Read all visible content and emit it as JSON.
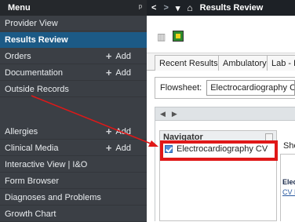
{
  "menu": {
    "title": "Menu",
    "pin": "𝟒",
    "items": [
      {
        "label": "Provider View"
      },
      {
        "label": "Results Review",
        "selected": true
      },
      {
        "label": "Orders",
        "add": "Add"
      },
      {
        "label": "Documentation",
        "add": "Add"
      },
      {
        "label": "Outside Records"
      },
      {
        "label": "Allergies",
        "add": "Add"
      },
      {
        "label": "Clinical Media",
        "add": "Add"
      },
      {
        "label": "Interactive View | I&O"
      },
      {
        "label": "Form Browser"
      },
      {
        "label": "Diagnoses and Problems"
      },
      {
        "label": "Growth Chart"
      }
    ]
  },
  "topbar": {
    "back": "<",
    "forward": ">",
    "dropdown": "▾",
    "home": "⌂",
    "title": "Results Review"
  },
  "tabs": [
    "Recent Results",
    "Ambulatory",
    "Lab - R"
  ],
  "flowsheet": {
    "label": "Flowsheet:",
    "value": "Electrocardiography CV"
  },
  "pager": {
    "prev": "◀",
    "next": "▶"
  },
  "navigator": {
    "title": "Navigator",
    "item": "Electrocardiography CV"
  },
  "content": {
    "show_label": "Sho",
    "elec_label": "Elec",
    "cve_label": "CV E"
  },
  "colors": {
    "menu_bg": "#3b3f45",
    "selected": "#1c5a86",
    "highlight": "#e01818"
  }
}
